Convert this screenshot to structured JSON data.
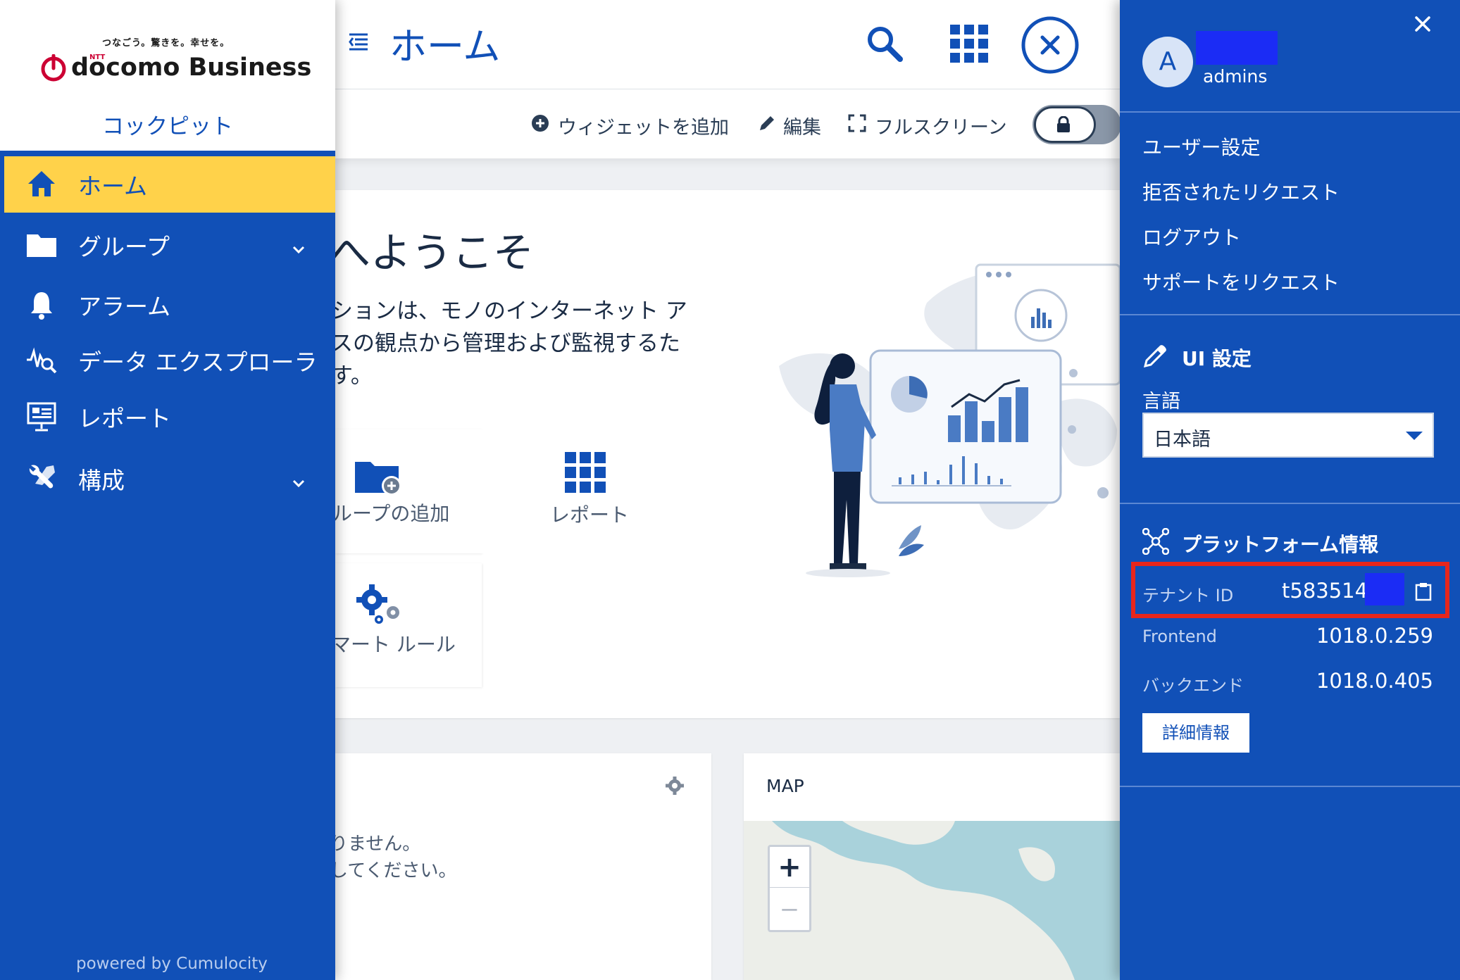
{
  "header": {
    "title": "ホーム"
  },
  "toolbar": {
    "add_widget": "ウィジェットを追加",
    "edit": "編集",
    "fullscreen": "フルスクリーン"
  },
  "sidebar": {
    "tagline": "つなごう。驚きを。幸せを。",
    "brand_ntt": "NTT",
    "brand_name": "docomo Business",
    "app_name": "コックピット",
    "items": [
      {
        "label": "ホーム",
        "icon": "home-icon",
        "active": true
      },
      {
        "label": "グループ",
        "icon": "folder-icon",
        "expandable": true
      },
      {
        "label": "アラーム",
        "icon": "bell-icon"
      },
      {
        "label": "データ エクスプローラ",
        "icon": "data-explorer-icon"
      },
      {
        "label": "レポート",
        "icon": "report-icon"
      },
      {
        "label": "構成",
        "icon": "wrench-icon",
        "expandable": true
      }
    ],
    "footer": "powered by Cumulocity"
  },
  "welcome": {
    "title": "へようこそ",
    "line1": "ションは、モノのインターネット ア",
    "line2": "スの観点から管理および監視するた",
    "line3": "す。",
    "quick_links": [
      {
        "label": "ループの追加",
        "icon": "add-group-icon"
      },
      {
        "label": "レポート",
        "icon": "grid-icon"
      },
      {
        "label": "マート ルール",
        "icon": "gears-icon"
      }
    ]
  },
  "widget_left": {
    "line1": "りません。",
    "line2": "してください。"
  },
  "map_widget": {
    "title": "MAP",
    "zoom_in": "+",
    "zoom_out": "−"
  },
  "user_panel": {
    "avatar_letter": "A",
    "username": "admins",
    "menu": [
      "ユーザー設定",
      "拒否されたリクエスト",
      "ログアウト",
      "サポートをリクエスト"
    ],
    "ui_settings_title": "UI 設定",
    "language_label": "言語",
    "language_value": "日本語",
    "platform_title": "プラットフォーム情報",
    "tenant_label": "テナント ID",
    "tenant_value": "t583514",
    "frontend_label": "Frontend",
    "frontend_value": "1018.0.259",
    "backend_label": "バックエンド",
    "backend_value": "1018.0.405",
    "details_button": "詳細情報"
  },
  "colors": {
    "brand_blue": "#1150b7",
    "active_yellow": "#ffd24a",
    "highlight_red": "#e8261c",
    "redaction_blue": "#1b2cf5",
    "docomo_red": "#cc0033"
  }
}
